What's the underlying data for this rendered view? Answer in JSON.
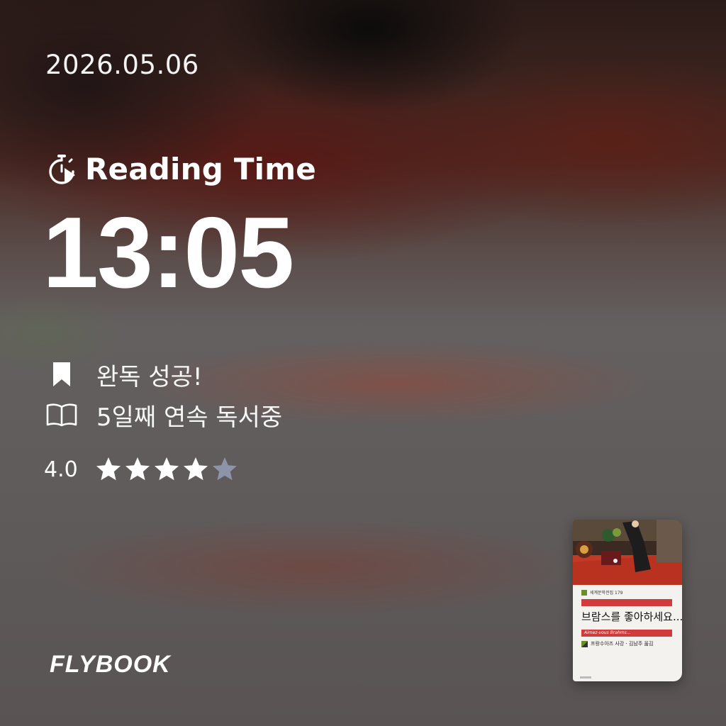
{
  "date": "2026.05.06",
  "reading_time": {
    "label": "Reading Time",
    "icon": "stopwatch-play-icon",
    "value": "13:05"
  },
  "status": [
    {
      "icon": "bookmark-icon",
      "text": "완독 성공!"
    },
    {
      "icon": "open-book-icon",
      "text": "5일째 연속 독서중"
    }
  ],
  "rating": {
    "value_text": "4.0",
    "value": 4,
    "max": 5,
    "filled_color": "#ffffff",
    "empty_color": "#8d93a8"
  },
  "brand": "FLYBOOK",
  "book": {
    "title": "브람스를 좋아하세요...",
    "series": "세계문학전집 179",
    "subtitle": "Aimez-vous Brahms...",
    "author": "프랑수아즈 사강 · 김남주 옮김"
  }
}
